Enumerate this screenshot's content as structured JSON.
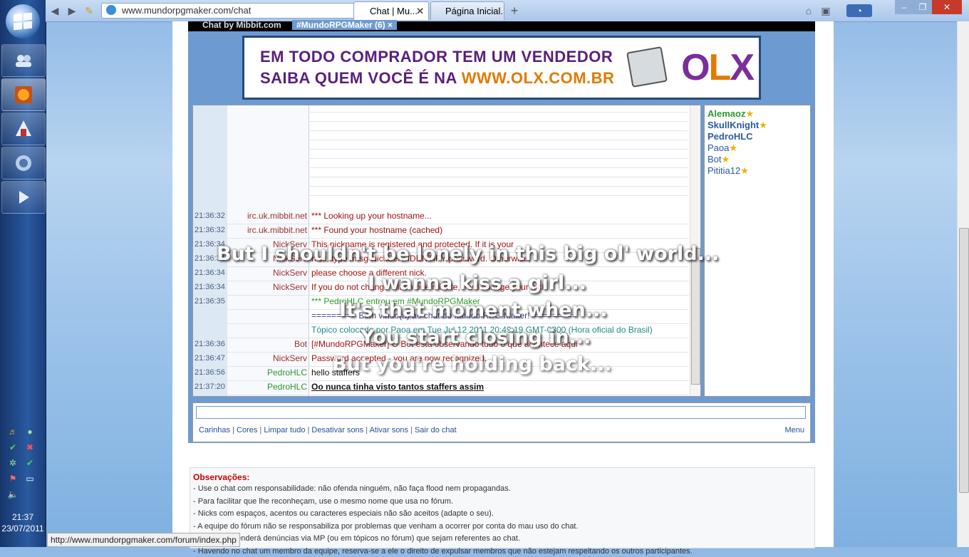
{
  "browser": {
    "url": "www.mundorpgmaker.com/chat",
    "tabs": [
      {
        "label": "Chat | Mu..."
      },
      {
        "label": "Página Inicial..."
      }
    ],
    "status_url": "http://www.mundorpgmaker.com/forum/index.php"
  },
  "taskbar": {
    "clock_time": "21:37",
    "clock_date": "23/07/2011"
  },
  "mibbit": {
    "logo": "Chat by Mibbit.com",
    "room_tab": "#MundoRPGMaker (6)",
    "room_close": "×"
  },
  "ad": {
    "line1": "EM TODO COMPRADOR TEM UM VENDEDOR",
    "line2_prefix": "SAIBA QUEM VOCÊ É NA",
    "line2_url": "WWW.OLX.COM.BR",
    "brand": [
      "O",
      "L",
      "X"
    ]
  },
  "chat": {
    "messages": [
      {
        "time": "21:36:32",
        "nick": "irc.uk.mibbit.net",
        "text": "*** Looking up your hostname...",
        "color": "#a01010"
      },
      {
        "time": "21:36:32",
        "nick": "irc.uk.mibbit.net",
        "text": "*** Found your hostname (cached)",
        "color": "#a01010"
      },
      {
        "time": "21:36:34",
        "nick": "NickServ",
        "text": "This nickname is registered and protected.  If it is your",
        "color": "#a01010"
      },
      {
        "time": "21:36:34",
        "nick": "NickServ",
        "text": "nick, type /msg NickServ IDENTIFY password.  Otherwise,",
        "color": "#a01010"
      },
      {
        "time": "21:36:34",
        "nick": "NickServ",
        "text": "please choose a different nick.",
        "color": "#a01010"
      },
      {
        "time": "21:36:34",
        "nick": "NickServ",
        "text": "If you do not change within one minute, I will change your nick.",
        "color": "#a01010"
      },
      {
        "time": "21:36:35",
        "nick": "",
        "text": "*** PedroHLC entrou em #MundoRPGMaker",
        "color": "#2a9a2a"
      },
      {
        "time": "",
        "nick": "",
        "text": "========= Bem vindo(a) ao chat do Mundo RPG Maker! =========",
        "color": "#3a3a9a"
      },
      {
        "time": "",
        "nick": "",
        "text": "Tópico colocado por Paoa em Tue Jul 12 2011 20:49:19 GMT-0300 (Hora oficial do Brasil)",
        "color": "#1e8a8a"
      },
      {
        "time": "21:36:36",
        "nick": "Bot",
        "text": "[#MundoRPGMaker] O Bot está observando tudo o que acontece aqui",
        "color": "#a01010"
      },
      {
        "time": "21:36:47",
        "nick": "NickServ",
        "text": "Password accepted - you are now recognized.",
        "color": "#a01010"
      },
      {
        "time": "21:36:56",
        "nick": "PedroHLC",
        "text": "hello staffers",
        "color": "#111111"
      },
      {
        "time": "21:37:20",
        "nick": "PedroHLC",
        "text": "Oo nunca tinha visto tantos staffers assim",
        "color": "#111111"
      }
    ]
  },
  "users": [
    {
      "name": "Alemaoz",
      "color": "#2e9a2e",
      "bold": true,
      "star": "★"
    },
    {
      "name": "SkullKnight",
      "color": "#2a5aa0",
      "bold": true,
      "star": "★"
    },
    {
      "name": "PedroHLC",
      "color": "#2a5aa0",
      "bold": true,
      "star": ""
    },
    {
      "name": "Paoa",
      "color": "#2a5aa0",
      "bold": false,
      "star": "★"
    },
    {
      "name": "Bot",
      "color": "#2a5aa0",
      "bold": false,
      "star": "★"
    },
    {
      "name": "Pititia12",
      "color": "#2a5aa0",
      "bold": false,
      "star": "★"
    }
  ],
  "toolbar_links": [
    "Carinhas",
    "Cores",
    "Limpar tudo",
    "Desativar sons",
    "Ativar sons",
    "Sair do chat"
  ],
  "menu_label": "Menu",
  "observacoes": {
    "title": "Observações:",
    "items": [
      "- Use o chat com responsabilidade: não ofenda ninguém, não faça flood nem propagandas.",
      "- Para facilitar que lhe reconheçam, use o mesmo nome que usa no fórum.",
      "- Nicks com espaços, acentos ou caracteres especiais não são aceitos (adapte o seu).",
      "- A equipe do fórum não se responsabiliza por problemas que venham a ocorrer por conta do mau uso do chat.",
      "- A equipe atenderá denúncias via MP (ou em tópicos no fórum) que sejam referentes ao chat.",
      "- Havendo no chat um membro da equipe, reserva-se a ele o direito de expulsar membros que não estejam respeitando os outros participantes."
    ]
  },
  "captions": [
    "But I shouldn't be lonely in this big ol' world...",
    "I wanna kiss a girl...",
    "It's that moment when...",
    "You start closing in...",
    "But you're holding back..."
  ]
}
